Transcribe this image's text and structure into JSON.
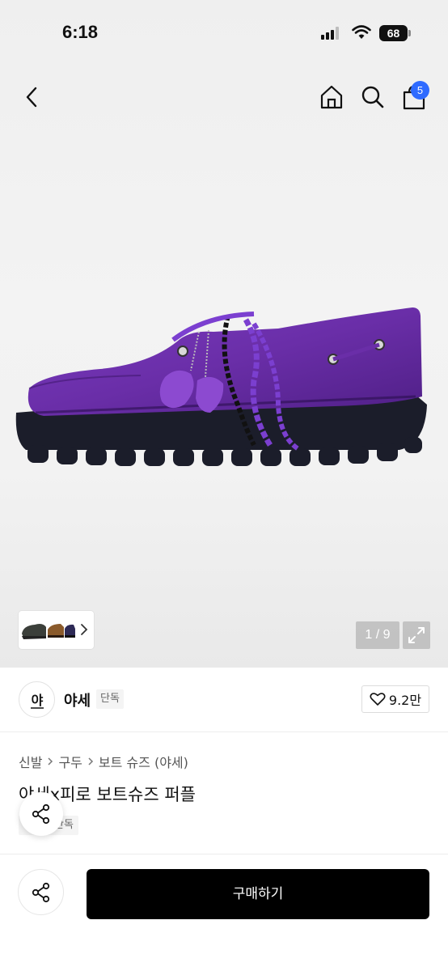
{
  "status_bar": {
    "time": "6:18",
    "battery": "68"
  },
  "nav": {
    "cart_count": "5"
  },
  "gallery": {
    "counter": "1 / 9"
  },
  "brand": {
    "logo_text": "야",
    "name": "야세",
    "tag": "단독",
    "likes": "9.2만"
  },
  "breadcrumb": [
    "신발",
    "구두",
    "보트 슈즈 (야세)"
  ],
  "product": {
    "title": "야세x피로 보트슈즈 퍼플",
    "tag": "단독"
  },
  "actions": {
    "buy_label": "구매하기"
  },
  "colors": {
    "accent": "#2f6bff",
    "primary_button": "#000000",
    "shoe": "#6a2ea8"
  }
}
